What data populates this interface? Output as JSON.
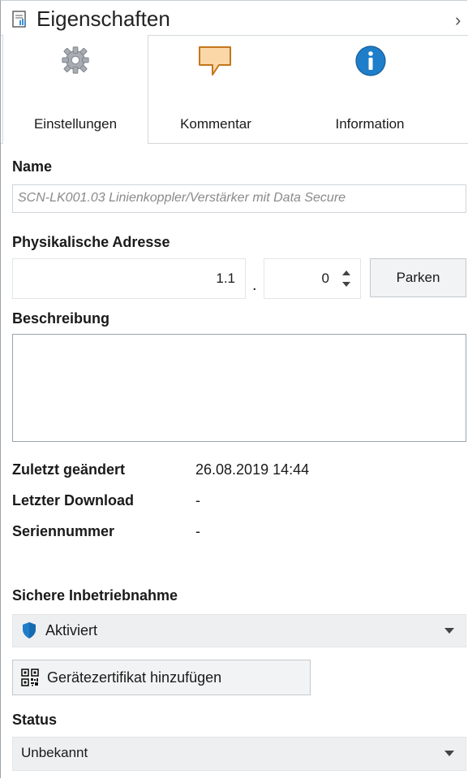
{
  "header": {
    "title": "Eigenschaften",
    "collapse_glyph": "›"
  },
  "tabs": [
    {
      "label": "Einstellungen",
      "icon": "gear-icon",
      "active": true
    },
    {
      "label": "Kommentar",
      "icon": "comment-icon",
      "active": false
    },
    {
      "label": "Information",
      "icon": "info-icon",
      "active": false
    }
  ],
  "name": {
    "label": "Name",
    "value": "SCN-LK001.03 Linienkoppler/Verstärker mit Data Secure"
  },
  "address": {
    "label": "Physikalische Adresse",
    "line": "1.1",
    "separator": ".",
    "device": "0",
    "park_button": "Parken"
  },
  "description": {
    "label": "Beschreibung",
    "value": ""
  },
  "info": [
    {
      "key": "Zuletzt geändert",
      "value": "26.08.2019 14:44"
    },
    {
      "key": "Letzter Download",
      "value": "-"
    },
    {
      "key": "Seriennummer",
      "value": "-"
    }
  ],
  "secure": {
    "label": "Sichere Inbetriebnahme",
    "selected": "Aktiviert",
    "icon": "shield-icon",
    "cert_button": "Gerätezertifikat hinzufügen",
    "cert_icon": "qr-code-icon"
  },
  "status": {
    "label": "Status",
    "selected": "Unbekannt"
  },
  "colors": {
    "accent": "#1f7ec9",
    "comment_fill": "#fbd7a8",
    "comment_stroke": "#c4761a",
    "border": "#9aa3ad"
  }
}
